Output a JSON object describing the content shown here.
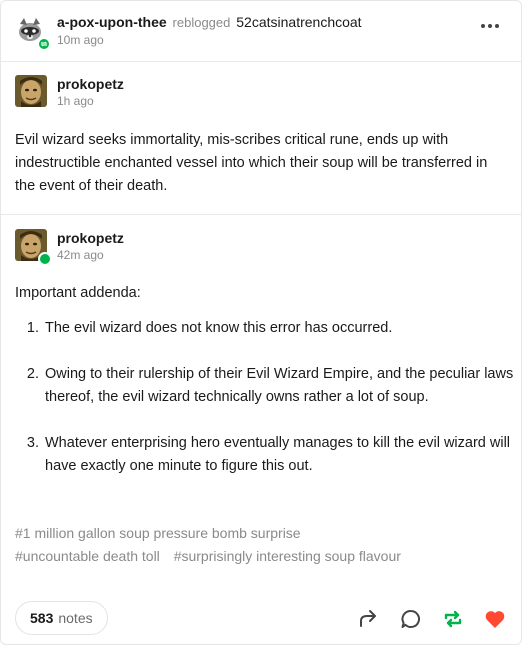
{
  "header": {
    "blog_name": "a-pox-upon-thee",
    "action": "reblogged",
    "source_blog": "52catsinatrenchcoat",
    "time": "10m ago"
  },
  "trail": [
    {
      "author": "prokopetz",
      "time": "1h ago",
      "body": "Evil wizard seeks immortality, mis-scribes critical rune, ends up with indestructible enchanted vessel into which their soup will be transferred in the event of their death."
    },
    {
      "author": "prokopetz",
      "time": "42m ago",
      "intro": "Important addenda:",
      "items": [
        "The evil wizard does not know this error has occurred.",
        "Owing to their rulership of their Evil Wizard Empire, and the peculiar laws thereof, the evil wizard technically owns rather a lot of soup.",
        "Whatever enterprising hero eventually manages to kill the evil wizard will have exactly one minute to figure this out."
      ]
    }
  ],
  "tags": [
    "#1 million gallon soup pressure bomb surprise",
    "#uncountable death toll",
    "#surprisingly interesting soup flavour"
  ],
  "footer": {
    "notes_count": "583",
    "notes_label": "notes"
  },
  "colors": {
    "reblog_green": "#00b34a",
    "like_orange": "#ff4930",
    "muted_text": "#8a8a8a"
  },
  "icons": [
    "more-icon",
    "share-icon",
    "reply-icon",
    "reblog-icon",
    "like-icon"
  ]
}
